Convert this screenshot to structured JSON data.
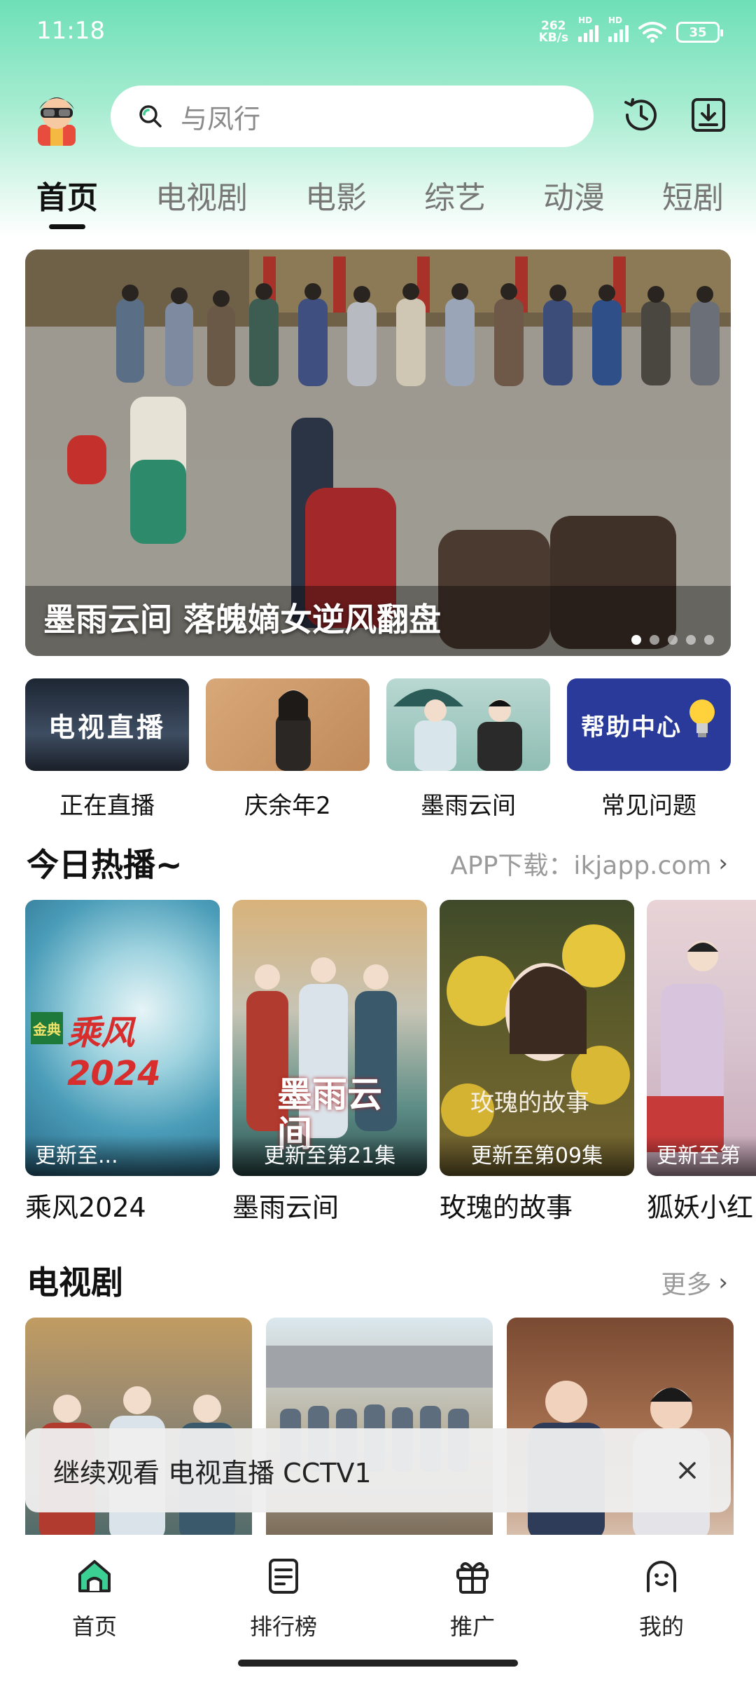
{
  "status_bar": {
    "time": "11:18",
    "net_speed_value": "262",
    "net_speed_unit": "KB/s",
    "hd_label": "HD",
    "battery": "35"
  },
  "header": {
    "search_placeholder": "与凤行"
  },
  "tabs": [
    "首页",
    "电视剧",
    "电影",
    "综艺",
    "动漫",
    "短剧"
  ],
  "banner": {
    "caption": "墨雨云间 落魄嫡女逆风翻盘",
    "slide_count": 5,
    "active_slide": 1
  },
  "quick_entries": [
    {
      "label": "正在直播",
      "thumb_text": "电视直播"
    },
    {
      "label": "庆余年2",
      "thumb_text": ""
    },
    {
      "label": "墨雨云间",
      "thumb_text": ""
    },
    {
      "label": "常见问题",
      "thumb_text": "帮助中心"
    }
  ],
  "hot_section": {
    "title": "今日热播~",
    "more": "APP下载：ikjapp.com",
    "items": [
      {
        "title": "乘风2024",
        "badge": "更新至..."
      },
      {
        "title": "墨雨云间",
        "badge": "更新至第21集"
      },
      {
        "title": "玫瑰的故事",
        "badge": "更新至第09集"
      },
      {
        "title": "狐妖小红",
        "badge": "更新至第"
      }
    ],
    "poster_texts": [
      "乘风2024",
      "金典",
      "墨雨云间",
      "玫瑰的故事"
    ]
  },
  "tv_section": {
    "title": "电视剧",
    "more": "更多"
  },
  "toast": {
    "text": "继续观看  电视直播 CCTV1"
  },
  "bottom_nav": [
    {
      "label": "首页",
      "icon": "home-icon"
    },
    {
      "label": "排行榜",
      "icon": "ranking-icon"
    },
    {
      "label": "推广",
      "icon": "gift-icon"
    },
    {
      "label": "我的",
      "icon": "profile-icon"
    }
  ],
  "colors": {
    "accent_green": "#3ccf94",
    "header_gradient_top": "#6ee0b8"
  }
}
